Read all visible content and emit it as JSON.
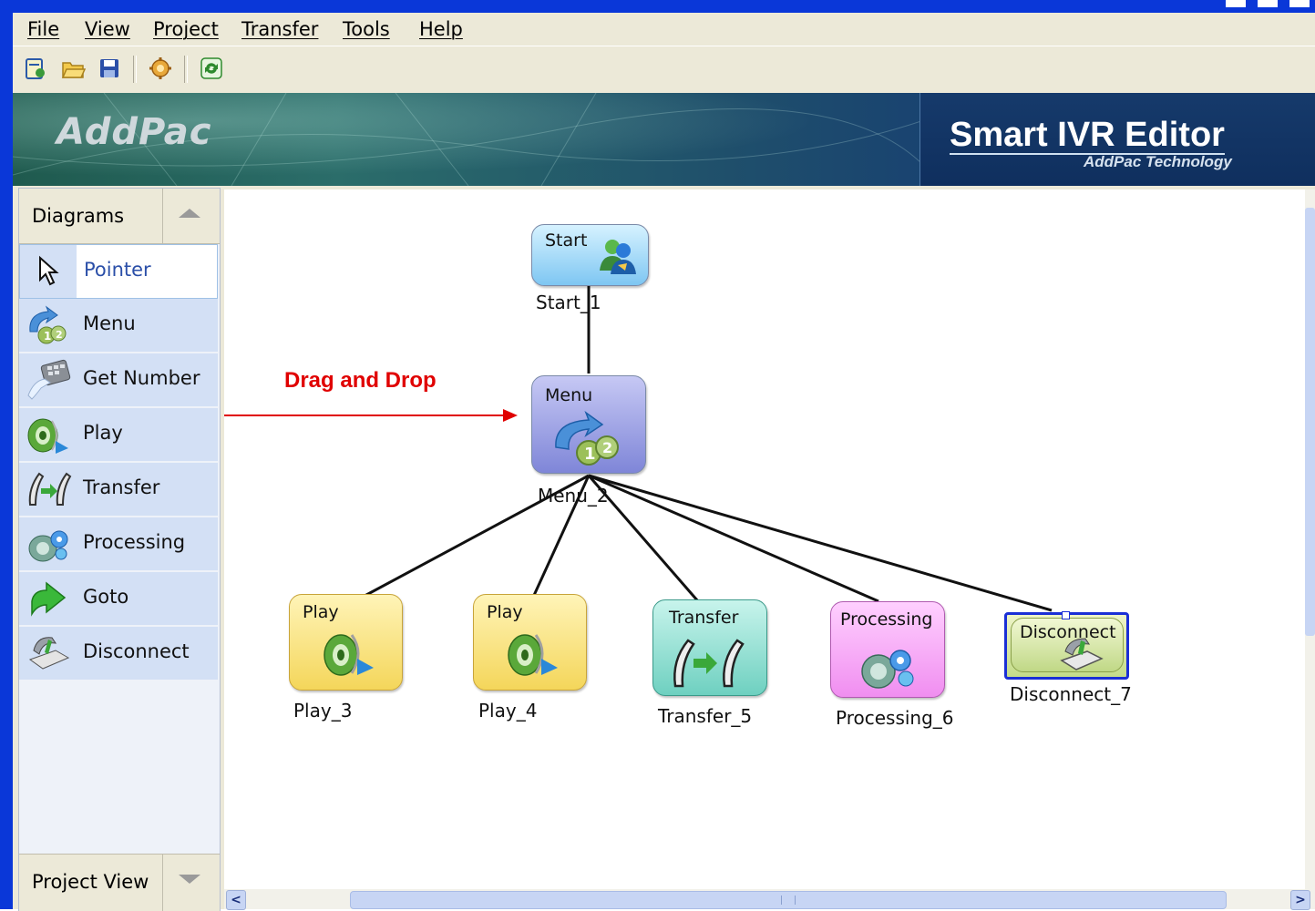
{
  "menubar": {
    "items": [
      "File",
      "View",
      "Project",
      "Transfer",
      "Tools",
      "Help"
    ]
  },
  "toolbar": {
    "buttons": [
      "new-icon",
      "open-folder-icon",
      "save-icon",
      "settings-gear-icon",
      "refresh-icon"
    ]
  },
  "banner": {
    "brand": "AddPac",
    "product": "Smart IVR Editor",
    "company": "AddPac Technology"
  },
  "palette": {
    "header": "Diagrams",
    "items": [
      {
        "label": "Pointer",
        "icon": "pointer-arrow-icon",
        "selected": true
      },
      {
        "label": "Menu",
        "icon": "menu-icon"
      },
      {
        "label": "Get Number",
        "icon": "get-number-icon"
      },
      {
        "label": "Play",
        "icon": "speaker-icon"
      },
      {
        "label": "Transfer",
        "icon": "transfer-phone-icon"
      },
      {
        "label": "Processing",
        "icon": "processing-gear-icon"
      },
      {
        "label": "Goto",
        "icon": "goto-arrow-icon"
      },
      {
        "label": "Disconnect",
        "icon": "disconnect-phone-icon"
      }
    ],
    "footer": "Project View"
  },
  "annotation": {
    "text": "Drag and Drop"
  },
  "diagram": {
    "nodes": [
      {
        "title": "Start",
        "caption": "Start_1"
      },
      {
        "title": "Menu",
        "caption": "Menu_2"
      },
      {
        "title": "Play",
        "caption": "Play_3"
      },
      {
        "title": "Play",
        "caption": "Play_4"
      },
      {
        "title": "Transfer",
        "caption": "Transfer_5"
      },
      {
        "title": "Processing",
        "caption": "Processing_6"
      },
      {
        "title": "Disconnect",
        "caption": "Disconnect_7",
        "selected": true
      }
    ]
  },
  "colors": {
    "window_frame": "#0a37d8",
    "selection": "#1a2fd6",
    "annotation": "#e00000"
  }
}
